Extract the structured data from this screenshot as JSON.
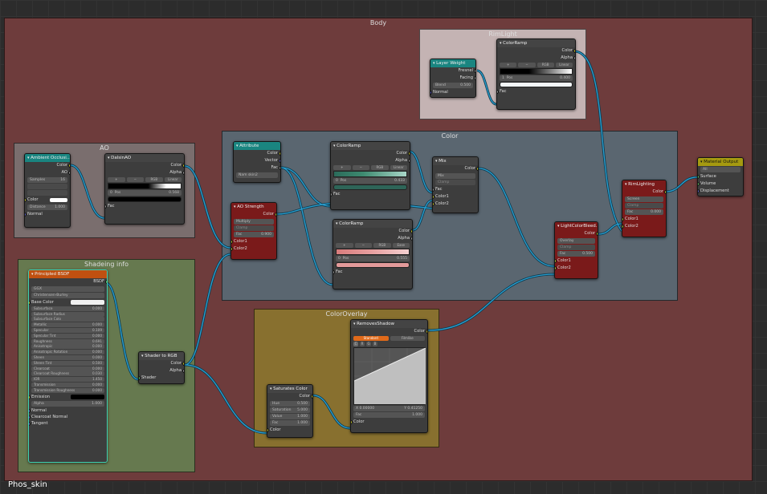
{
  "tree_name": "Phos_skin",
  "frames": {
    "body": "Body",
    "rim": "RimLight",
    "color": "Color",
    "ao": "AO",
    "shade": "Shadeing info",
    "overlay": "ColorOverlay"
  },
  "nodes": {
    "layer_weight": {
      "title": "Layer Weight",
      "fresnel": "Fresnel",
      "facing": "Facing",
      "blend": "Blend",
      "blend_val": "0.500",
      "normal": "Normal"
    },
    "rim_ramp": {
      "title": "ColorRamp",
      "color": "Color",
      "alpha": "Alpha",
      "rgb": "RGB",
      "interp": "Linear",
      "idx": "1",
      "pos": "Pos",
      "pos_val": "0.400",
      "fac": "Fac"
    },
    "amb_occ": {
      "title": "Ambient Occlusi...",
      "color": "Color",
      "ao": "AO",
      "samples": "Samples",
      "samples_val": "16",
      "color_in": "Color",
      "distance": "Distance",
      "distance_val": "1.000",
      "normal": "Normal"
    },
    "dalsin": {
      "title": "DalsinAO",
      "color": "Color",
      "alpha": "Alpha",
      "rgb": "RGB",
      "interp": "Linear",
      "idx": "0",
      "pos": "Pos",
      "pos_val": "0.568",
      "fac": "Fac"
    },
    "attribute": {
      "title": "Attribute",
      "color": "Color",
      "vector": "Vector",
      "fac": "Fac",
      "name": "Nam",
      "name_val": "skin2"
    },
    "ramp1": {
      "title": "ColorRamp",
      "color": "Color",
      "alpha": "Alpha",
      "rgb": "RGB",
      "interp": "Linear",
      "idx": "0",
      "pos": "Pos",
      "pos_val": "0.433",
      "fac": "Fac"
    },
    "ramp2": {
      "title": "ColorRamp",
      "color": "Color",
      "alpha": "Alpha",
      "rgb": "RGB",
      "interp": "Ease",
      "idx": "0",
      "pos": "Pos",
      "pos_val": "0.555",
      "fac": "Fac"
    },
    "mix": {
      "title": "Mix",
      "color": "Color",
      "mode": "Mix",
      "clamp": "Clamp",
      "fac": "Fac",
      "c1": "Color1",
      "c2": "Color2"
    },
    "ao_strength": {
      "title": "AO Strength",
      "color": "Color",
      "mode": "Multiply",
      "clamp": "Clamp",
      "fac": "Fac",
      "fac_val": "0.900",
      "c1": "Color1",
      "c2": "Color2"
    },
    "light_bleed": {
      "title": "LightColorBleed...",
      "color": "Color",
      "mode": "Overlay",
      "clamp": "Clamp",
      "fac": "Fac",
      "fac_val": "0.500",
      "c1": "Color1",
      "c2": "Color2"
    },
    "rim_light": {
      "title": "RimLighting",
      "color": "Color",
      "mode": "Screen",
      "clamp": "Clamp",
      "fac": "Fac",
      "fac_val": "0.000",
      "c1": "Color1",
      "c2": "Color2"
    },
    "mat_out": {
      "title": "Material Output",
      "all": "All",
      "surface": "Surface",
      "volume": "Volume",
      "displacement": "Displacement"
    },
    "bsdf": {
      "title": "Principled BSDF",
      "out": "BSDF",
      "dist": "GGX",
      "ss": "Christensen-Burley",
      "base_color": "Base Color",
      "rows": [
        [
          "Subsurface",
          "0.000"
        ],
        [
          "Subsurface Radius",
          ""
        ],
        [
          "Subsurface Colo",
          ""
        ],
        [
          "Metallic",
          "0.000"
        ],
        [
          "Specular",
          "0.109"
        ],
        [
          "Specular Tint",
          "0.000"
        ],
        [
          "Roughness",
          "0.691"
        ],
        [
          "Anisotropic",
          "0.000"
        ],
        [
          "Anisotropic Rotation",
          "0.000"
        ],
        [
          "Sheen",
          "0.000"
        ],
        [
          "Sheen Tint",
          "0.500"
        ],
        [
          "Clearcoat",
          "0.000"
        ],
        [
          "Clearcoat Roughness",
          "0.030"
        ],
        [
          "IOR",
          "1.450"
        ],
        [
          "Transmission",
          "0.000"
        ],
        [
          "Transmission Roughness",
          "0.000"
        ]
      ],
      "emission": "Emission",
      "alpha": "Alpha",
      "alpha_val": "1.000",
      "normal": "Normal",
      "cc_normal": "Clearcoat Normal",
      "tangent": "Tangent"
    },
    "shader_rgb": {
      "title": "Shader to RGB",
      "color": "Color",
      "alpha": "Alpha",
      "shader": "Shader"
    },
    "saturate": {
      "title": "Saturates Color",
      "color": "Color",
      "hue": "Hue",
      "hue_val": "0.500",
      "sat": "Saturation",
      "sat_val": "5.000",
      "value": "Value",
      "value_val": "1.000",
      "fac": "Fac",
      "fac_val": "1.000",
      "color_in": "Color"
    },
    "remove_shadow": {
      "title": "RemovesShadow",
      "color": "Color",
      "std": "Standard",
      "film": "Filmlike",
      "c": "C",
      "r": "R",
      "g": "G",
      "b": "B",
      "x": "X 0.00000",
      "y": "Y 0.41250",
      "fac": "Fac",
      "fac_val": "1.000",
      "color_in": "Color"
    }
  }
}
